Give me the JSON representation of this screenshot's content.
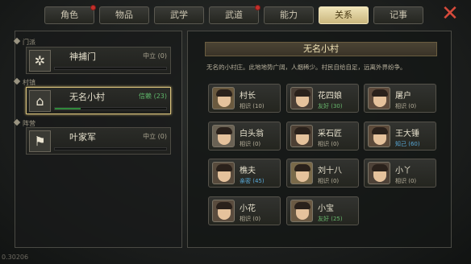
{
  "tabs": [
    {
      "label": "角色",
      "badge": true
    },
    {
      "label": "物品",
      "badge": false
    },
    {
      "label": "武学",
      "badge": false
    },
    {
      "label": "武道",
      "badge": true
    },
    {
      "label": "能力",
      "badge": false
    },
    {
      "label": "关系",
      "badge": false,
      "active": true
    },
    {
      "label": "记事",
      "badge": false
    }
  ],
  "close_icon": "✕",
  "left": {
    "groups": [
      {
        "label": "门派",
        "factions": [
          {
            "name": "神捕门",
            "relation": "中立 (0)",
            "emblem_icon": "spider-icon",
            "emblem_glyph": "✲",
            "level": 0.0
          }
        ]
      },
      {
        "label": "村镇",
        "factions": [
          {
            "name": "无名小村",
            "relation": "信赖 (23)",
            "emblem_icon": "house-icon",
            "emblem_glyph": "⌂",
            "level": 0.23,
            "selected": true
          }
        ]
      },
      {
        "label": "阵营",
        "factions": [
          {
            "name": "叶家军",
            "relation": "中立 (0)",
            "emblem_icon": "flag-icon",
            "emblem_glyph": "⚑",
            "level": 0.0
          }
        ]
      }
    ]
  },
  "village": {
    "title": "无名小村",
    "description": "无名的小村庄。此地地势广阔，人烟稀少。村民自给自足，远离外界纷争。"
  },
  "npcs": [
    {
      "name": "村长",
      "relation": "相识 (10)"
    },
    {
      "name": "花四娘",
      "relation": "友好 (30)"
    },
    {
      "name": "屠户",
      "relation": "相识 (0)"
    },
    {
      "name": "白头翁",
      "relation": "相识 (0)"
    },
    {
      "name": "采石匠",
      "relation": "相识 (0)"
    },
    {
      "name": "王大锤",
      "relation": "知己 (60)"
    },
    {
      "name": "樵夫",
      "relation": "亲密 (45)"
    },
    {
      "name": "刘十八",
      "relation": "相识 (0)"
    },
    {
      "name": "小丫",
      "relation": "相识 (0)"
    },
    {
      "name": "小花",
      "relation": "相识 (0)"
    },
    {
      "name": "小宝",
      "relation": "友好 (25)"
    }
  ],
  "colors": {
    "accent_gold": "#d8c17b",
    "relation_green": "#5fb86b",
    "relation_blue": "#58a8d6",
    "close_red": "#d64a3b"
  },
  "footer": "0.30206"
}
